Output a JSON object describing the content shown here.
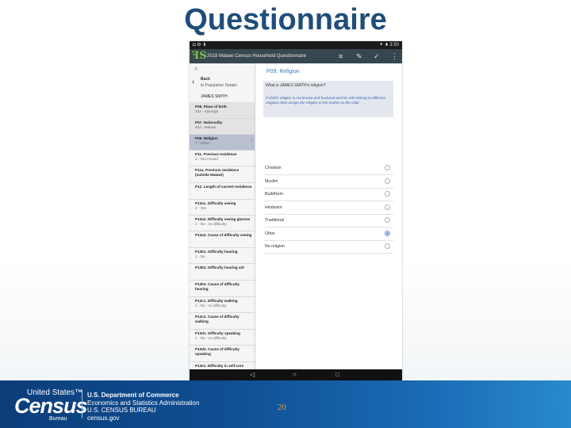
{
  "slide": {
    "title": "Questionnaire",
    "page_number": "20"
  },
  "statusbar": {
    "left": "◘  ⚙  ⬇",
    "right": "⯆ ▮ 3:50"
  },
  "appbar": {
    "title": "2018 Malawi Census Household Questionnaire",
    "icons": [
      "hamburger-icon",
      "edit-icon",
      "check-icon",
      "overflow-icon"
    ]
  },
  "sidebar": {
    "search_icon": "⌕",
    "back_label": "Back",
    "back_sub": "to Population Details",
    "person_name": "JAMES SMITH",
    "items": [
      {
        "name": "P05. Place of birth",
        "sub": "102 - Karonga",
        "state": "done"
      },
      {
        "name": "P07. Nationality",
        "sub": "454 - Malawi",
        "state": "done"
      },
      {
        "name": "P09. Religion",
        "sub": "7 - Other",
        "state": "active"
      },
      {
        "name": "P11. Previous residence",
        "sub": "2 - Not moved",
        "state": ""
      },
      {
        "name": "P11a. Previous residence (outside Malawi)",
        "sub": "",
        "state": ""
      },
      {
        "name": "P12. Length of current residence",
        "sub": "",
        "state": ""
      },
      {
        "name": "P13a1. Difficulty seeing",
        "sub": "2 - Yes",
        "state": ""
      },
      {
        "name": "P13a2. Difficulty seeing glasses",
        "sub": "1 - No - no difficulty",
        "state": ""
      },
      {
        "name": "P13a3. Cause of difficulty seeing",
        "sub": "",
        "state": ""
      },
      {
        "name": "P13b1. Difficulty hearing",
        "sub": "1 - No",
        "state": ""
      },
      {
        "name": "P13b2. Difficulty hearing aid",
        "sub": "",
        "state": ""
      },
      {
        "name": "P13b3. Cause of difficulty hearing",
        "sub": "",
        "state": ""
      },
      {
        "name": "P13c1. Difficulty walking",
        "sub": "1 - No - no difficulty",
        "state": ""
      },
      {
        "name": "P13c2. Cause of difficulty walking",
        "sub": "",
        "state": ""
      },
      {
        "name": "P13d1. Difficulty speaking",
        "sub": "1 - No - no difficulty",
        "state": ""
      },
      {
        "name": "P13d2. Cause of difficulty speaking",
        "sub": "",
        "state": ""
      },
      {
        "name": "P13e1. Difficulty in self-care",
        "sub": "",
        "state": ""
      }
    ]
  },
  "question": {
    "title": "P09. Religion",
    "text": "What is JAMES SMITH's religion?",
    "note": "If child's religion is not known and husband and his wife belong to different religions then assign the religion of the mother to the child",
    "options": [
      {
        "label": "Christian",
        "selected": false
      },
      {
        "label": "Muslim",
        "selected": false
      },
      {
        "label": "Buddhism",
        "selected": false
      },
      {
        "label": "Hinduism",
        "selected": false
      },
      {
        "label": "Traditional",
        "selected": false
      },
      {
        "label": "Other",
        "selected": true
      },
      {
        "label": "No religion",
        "selected": false
      }
    ]
  },
  "navbar": {
    "back": "◁",
    "home": "○",
    "recent": "□"
  },
  "footer": {
    "brand_top": "United States™",
    "brand_main": "Census",
    "brand_sub": "Bureau",
    "dept_line1": "U.S. Department of Commerce",
    "dept_line2": "Economics and Statistics Administration",
    "dept_line3": "U.S. CENSUS BUREAU",
    "dept_line4": "census.gov"
  }
}
